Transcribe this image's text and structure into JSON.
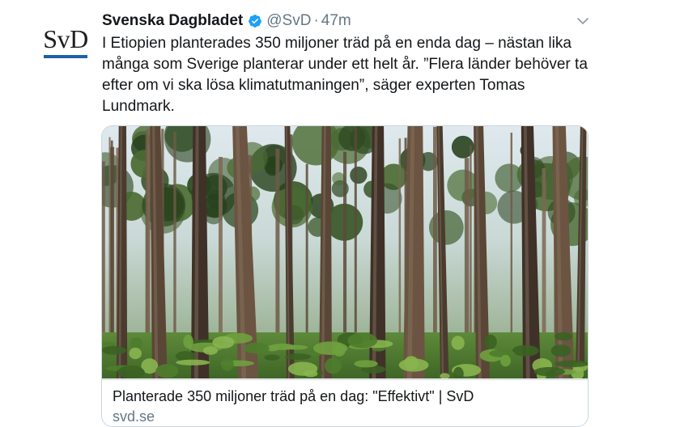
{
  "avatar": {
    "logo_text": "SvD"
  },
  "header": {
    "display_name": "Svenska Dagbladet",
    "handle": "@SvD",
    "separator": "·",
    "time": "47m"
  },
  "icons": {
    "verified": "verified-badge-icon",
    "menu": "chevron-down-icon"
  },
  "tweet": {
    "text": "I Etiopien planterades 350 miljoner träd på en enda dag – nästan lika\nmånga som Sverige planterar under ett helt år. ”Flera länder behöver ta\nefter om vi ska lösa klimatutmaningen”, säger experten Tomas\nLundmark."
  },
  "card": {
    "image_subject": "pine-forest-photo",
    "title": "Planterade 350 miljoner träd på en dag: \"Effektivt\" | SvD",
    "domain": "svd.se"
  },
  "colors": {
    "verified_blue": "#1da1f2",
    "logo_bar": "#1f5fa8",
    "secondary_text": "#657786",
    "border": "#ccd6dd"
  }
}
